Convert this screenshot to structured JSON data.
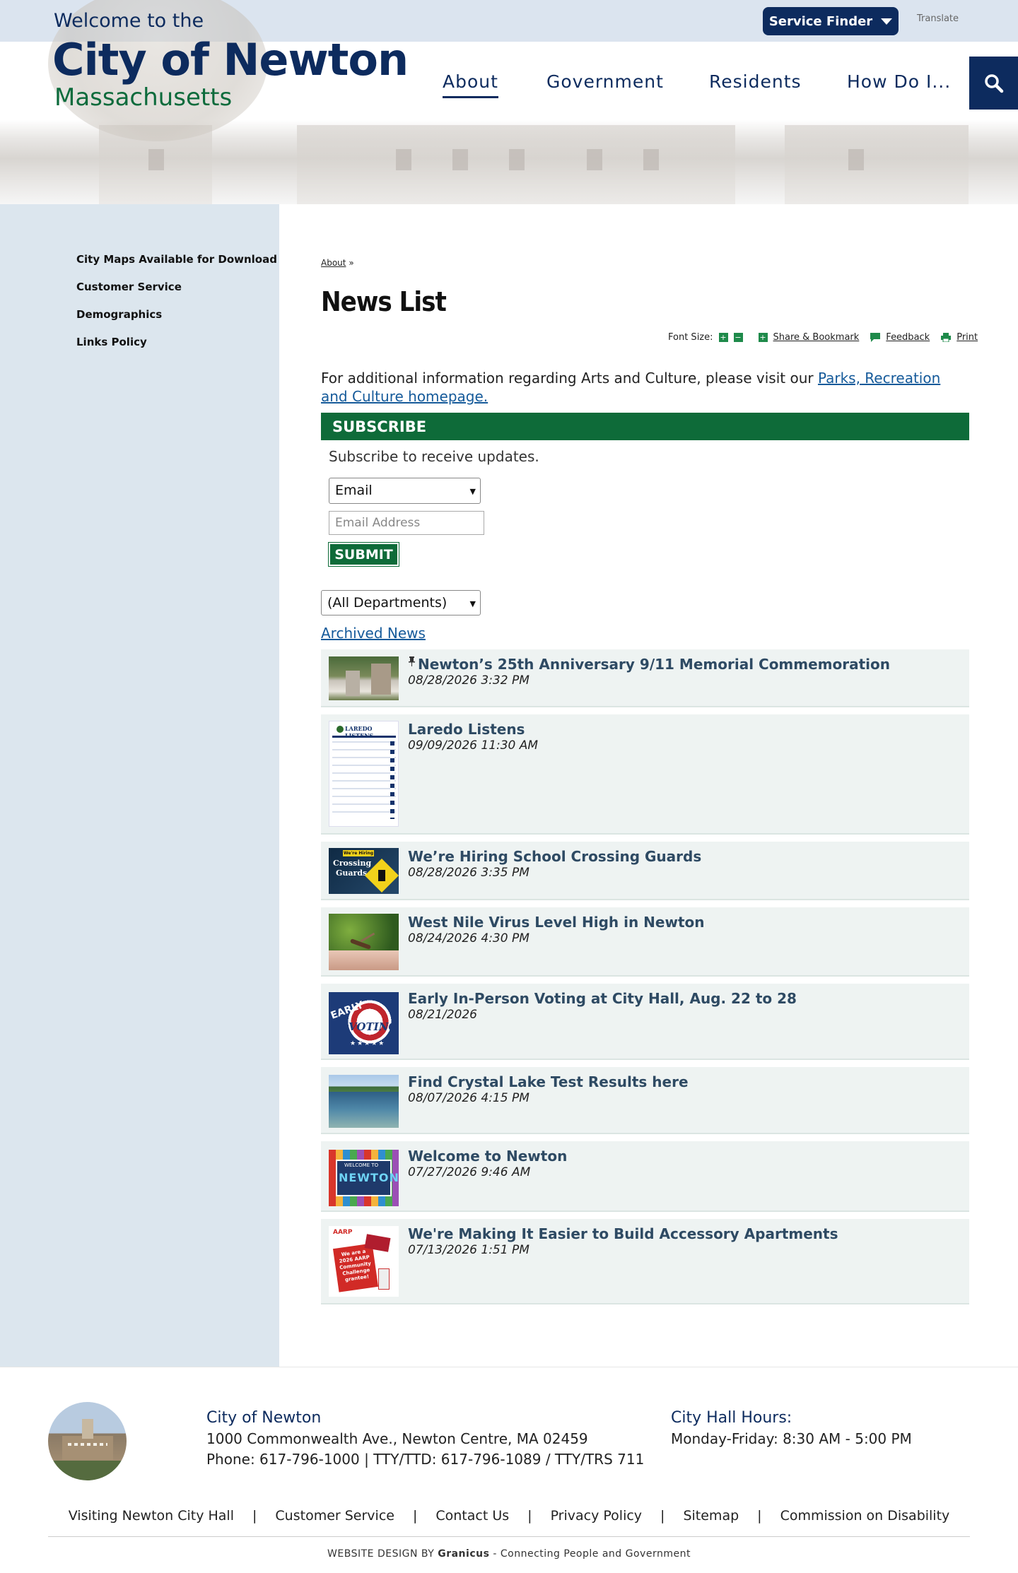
{
  "header": {
    "welcome": "Welcome to the",
    "city": "City of Newton",
    "state": "Massachusetts",
    "service_finder": "Service Finder",
    "translate": "Translate",
    "nav": [
      "About",
      "Government",
      "Residents",
      "How Do I..."
    ]
  },
  "sidebar": {
    "items": [
      "City Maps Available for Download",
      "Customer Service",
      "Demographics",
      "Links Policy"
    ]
  },
  "breadcrumb": {
    "link": "About",
    "sep": "»"
  },
  "page_title": "News List",
  "tools": {
    "font_size": "Font Size:",
    "plus": "+",
    "minus": "−",
    "share": "Share & Bookmark",
    "feedback": "Feedback",
    "print": "Print"
  },
  "intro": {
    "text": "For additional information regarding Arts and Culture, please visit our ",
    "link": "Parks, Recreation and Culture homepage."
  },
  "subscribe": {
    "heading": "SUBSCRIBE",
    "text": "Subscribe to receive updates.",
    "select_value": "Email",
    "placeholder": "Email Address",
    "submit": "SUBMIT"
  },
  "filter": {
    "department": "(All Departments)"
  },
  "archived": "Archived News",
  "news": [
    {
      "title": "Newton’s 25th Anniversary 9/11 Memorial Commemoration",
      "date": "08/28/2026 3:32 PM",
      "pinned": true,
      "pin_icon": "pin-icon"
    },
    {
      "title": "Laredo Listens",
      "date": "09/09/2026 11:30 AM"
    },
    {
      "title": "We’re Hiring School Crossing Guards",
      "date": "08/28/2026 3:35 PM"
    },
    {
      "title": "West Nile Virus Level High in Newton",
      "date": "08/24/2026 4:30 PM"
    },
    {
      "title": "Early In-Person Voting at City Hall, Aug. 22 to 28",
      "date": "08/21/2026"
    },
    {
      "title": "Find Crystal Lake Test Results here",
      "date": "08/07/2026 4:15 PM"
    },
    {
      "title": "Welcome to Newton",
      "date": "07/27/2026 9:46 AM"
    },
    {
      "title": "We're Making It Easier to Build Accessory Apartments",
      "date": "07/13/2026 1:51 PM"
    }
  ],
  "thumb_text": {
    "laredo": "LAREDO LISTENS",
    "hiring1": "We're Hiring",
    "hiring2": "Crossing",
    "hiring3": "Guards",
    "early": "EARLY",
    "voting": "VOTING",
    "welcome_small": "WELCOME TO",
    "welcome_big": "NEWTON",
    "aarp": "AARP",
    "aarp_card": "We are a 2026 AARP Community Challenge grantee!"
  },
  "footer": {
    "city": "City of Newton",
    "address": "1000 Commonwealth Ave., Newton Centre, MA 02459",
    "phone": "Phone: 617-796-1000 | TTY/TTD: 617-796-1089 / TTY/TRS 711",
    "hours_title": "City Hall Hours:",
    "hours": "Monday-Friday: 8:30 AM - 5:00 PM",
    "links": [
      "Visiting Newton City Hall",
      "Customer Service",
      "Contact Us",
      "Privacy Policy",
      "Sitemap",
      "Commission on Disability"
    ],
    "link_sep": "|",
    "credit_prefix": "WEBSITE DESIGN BY ",
    "credit_brand": "Granicus",
    "credit_suffix": " - Connecting People and Government"
  },
  "colors": {
    "navy": "#0d2b5e",
    "green": "#0e6b39",
    "sidebar": "#dce6ee",
    "news_bg": "#eef3f2"
  }
}
